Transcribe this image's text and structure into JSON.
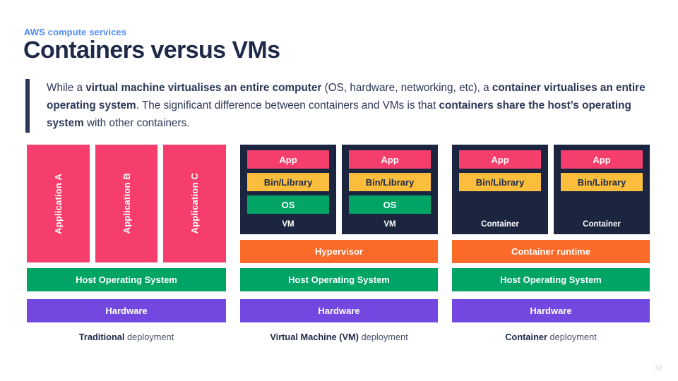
{
  "header": {
    "eyebrow": "AWS compute services",
    "title": "Containers versus VMs"
  },
  "callout": {
    "segments": [
      {
        "text": "While a ",
        "bold": false
      },
      {
        "text": "virtual machine virtualises an entire computer",
        "bold": true
      },
      {
        "text": " (OS, hardware, networking, etc), a ",
        "bold": false
      },
      {
        "text": "container virtualises an entire operating system",
        "bold": true
      },
      {
        "text": ". The significant difference between containers and VMs is that ",
        "bold": false
      },
      {
        "text": "containers share the host’s operating system",
        "bold": true
      },
      {
        "text": " with other containers.",
        "bold": false
      }
    ],
    "plain_text": "While a virtual machine virtualises an entire computer (OS, hardware, networking, etc), a container virtualises an entire operating system. The significant difference between containers and VMs is that containers share the host’s operating system with other containers."
  },
  "diagram": {
    "columns": [
      {
        "id": "traditional",
        "apps": [
          {
            "label": "Application A"
          },
          {
            "label": "Application B"
          },
          {
            "label": "Application C"
          }
        ],
        "host_os": "Host Operating System",
        "hardware": "Hardware",
        "caption_bold": "Traditional",
        "caption_rest": " deployment"
      },
      {
        "id": "virtual-machine",
        "boxes": [
          {
            "layers": [
              {
                "label": "App",
                "color": "pink"
              },
              {
                "label": "Bin/Library",
                "color": "yellow"
              },
              {
                "label": "OS",
                "color": "green"
              }
            ],
            "box_label": "VM"
          },
          {
            "layers": [
              {
                "label": "App",
                "color": "pink"
              },
              {
                "label": "Bin/Library",
                "color": "yellow"
              },
              {
                "label": "OS",
                "color": "green"
              }
            ],
            "box_label": "VM"
          }
        ],
        "middleware": "Hypervisor",
        "host_os": "Host Operating System",
        "hardware": "Hardware",
        "caption_bold": "Virtual Machine (VM)",
        "caption_rest": " deployment"
      },
      {
        "id": "container",
        "boxes": [
          {
            "layers": [
              {
                "label": "App",
                "color": "pink"
              },
              {
                "label": "Bin/Library",
                "color": "yellow"
              }
            ],
            "box_label": "Container"
          },
          {
            "layers": [
              {
                "label": "App",
                "color": "pink"
              },
              {
                "label": "Bin/Library",
                "color": "yellow"
              }
            ],
            "box_label": "Container"
          }
        ],
        "middleware": "Container runtime",
        "host_os": "Host Operating System",
        "hardware": "Hardware",
        "caption_bold": "Container",
        "caption_rest": " deployment"
      }
    ]
  },
  "footer": {
    "page_number": "32"
  },
  "colors": {
    "accent_blue": "#4f8df9",
    "navy": "#1e2a47",
    "box_navy": "#1b2540",
    "pink": "#f53e6b",
    "yellow": "#fbbd3c",
    "green": "#00a566",
    "orange": "#fa6a28",
    "purple": "#7248e0",
    "page_number": "#dcdfe8"
  }
}
